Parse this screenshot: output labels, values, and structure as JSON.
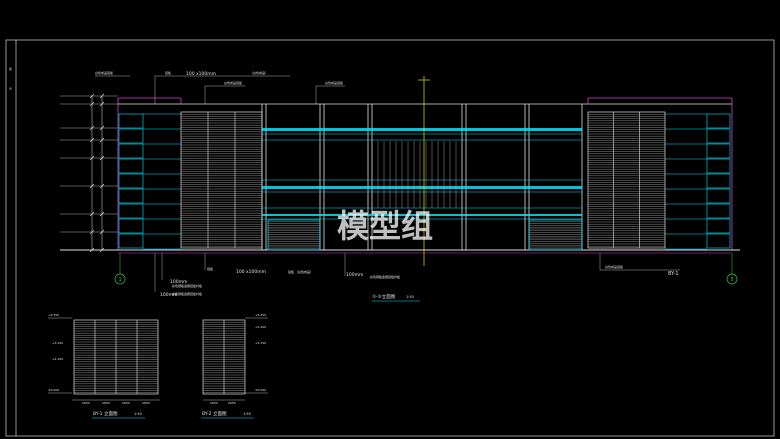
{
  "colors": {
    "background": "#000000",
    "frame": "#bbbbbb",
    "cyan": "#00e5ff",
    "magenta": "#d040d0",
    "white": "#e0e0e0",
    "yellow": "#e6e600",
    "green": "#30d030",
    "watermark": "#ffffff"
  },
  "watermark": "模型组",
  "annotations": {
    "spec_top": "100 x100mm",
    "spec_bottom": "100 x100mm",
    "dim_100_a": "100mm",
    "dim_100_b": "100mm",
    "dim_100_c": "100mm",
    "by1_tag": "BY-1",
    "grid_left": "1",
    "grid_right": "5"
  },
  "titles": {
    "main": "①-⑤立面图",
    "main_scale": "1:50",
    "detail_1": "BY-1 立面图",
    "detail_1_scale": "1:50",
    "detail_2": "BY-2 立面图",
    "detail_2_scale": "1:50"
  }
}
